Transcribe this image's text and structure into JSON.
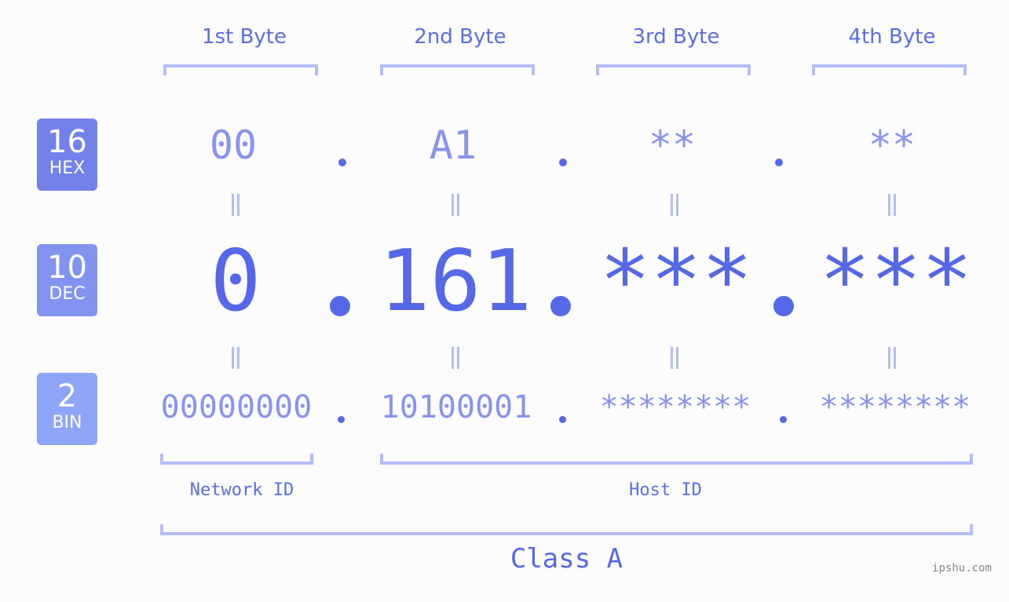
{
  "bytes": [
    {
      "label": "1st Byte",
      "hex": "00",
      "dec": "0",
      "bin": "00000000"
    },
    {
      "label": "2nd Byte",
      "hex": "A1",
      "dec": "161",
      "bin": "10100001"
    },
    {
      "label": "3rd Byte",
      "hex": "**",
      "dec": "***",
      "bin": "********"
    },
    {
      "label": "4th Byte",
      "hex": "**",
      "dec": "***",
      "bin": "********"
    }
  ],
  "badges": {
    "hex": {
      "num": "16",
      "sub": "HEX",
      "color": "#7381ea"
    },
    "dec": {
      "num": "10",
      "sub": "DEC",
      "color": "#8393f0"
    },
    "bin": {
      "num": "2",
      "sub": "BIN",
      "color": "#8fa5f7"
    }
  },
  "labels": {
    "network_id": "Network ID",
    "host_id": "Host ID",
    "class": "Class A"
  },
  "watermark": "ipshu.com",
  "colors": {
    "accent": "#5468e8",
    "light": "#8793ee",
    "bracket": "#b3bdf7",
    "background": "#fbfcfb"
  }
}
